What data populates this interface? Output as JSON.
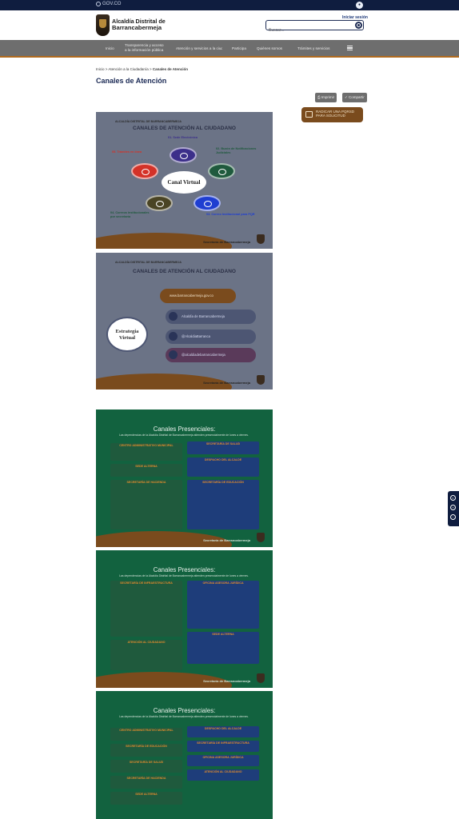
{
  "govbar": {
    "label": "GOV.CO"
  },
  "header": {
    "logo_line1": "Alcaldía Distrital de",
    "logo_line2": "Barrancabermeja",
    "login": "Iniciar sesión",
    "search_placeholder": "Buscar..."
  },
  "nav": {
    "items": [
      "Inicio",
      "Transparencia y acceso a la información pública",
      "Atención y servicios a la ciudadanía",
      "Participa",
      "Quiénes somos",
      "Trámites y servicios"
    ]
  },
  "breadcrumb": {
    "home": "Inicio",
    "middle": "Atención a la Ciudadanía",
    "current": "Canales de Atención"
  },
  "page": {
    "title": "Canales de Atención"
  },
  "actions": {
    "print": "Imprimir",
    "share": "Compartir",
    "pqrsd": "RADICAR UNA PQRSD PARA SOLICITUD"
  },
  "images": {
    "virtual_header": "ALCALDÍA DISTRITAL DE BARRANCABERMEJA",
    "virtual_title": "CANALES DE ATENCIÓN AL CIUDADANO",
    "virtual_center": "Canal Virtual",
    "virtual_labels": [
      "01. Sede Electrónica",
      "02. Buzón de Notificaciones Judiciales",
      "03. Correo Institucional para PQR",
      "04. Correos institucionales por secretaría",
      "05. Trámites en línea"
    ],
    "strategy_title": "CANALES DE ATENCIÓN AL CIUDADANO",
    "strategy_center_line1": "Estrategia",
    "strategy_center_line2": "Virtual",
    "strategy_pills": [
      "www.barrancabermeja.gov.co",
      "Alcaldía de Barrancabermeja",
      "@AlcaldiaBarranca",
      "@alcaldiadebarrancabermeja"
    ],
    "presencial_title": "Canales Presenciales:",
    "presencial_sub": "Las dependencias de la Alcaldía Distrital de Barrancabermeja atienden presencialmente de lunes a viernes.",
    "presencial_boxes": [
      "CENTRO ADMINISTRATIVO MUNICIPAL",
      "SECRETARÍA DE SALUD",
      "SEDE ALTERNA",
      "DESPACHO DEL ALCALDE",
      "SECRETARÍA DE HACIENDA",
      "SECRETARÍA DE EDUCACIÓN",
      "SECRETARÍA DE INFRAESTRUCTURA",
      "OFICINA ASESORA JURÍDICA",
      "ATENCIÓN AL CIUDADANO"
    ],
    "brand": "Secretaría de Barrancabermeja"
  },
  "colors": {
    "navy": "#0f1d3f",
    "brown": "#7a4b1d",
    "nav": "#6e6e6e",
    "green": "#12623f"
  }
}
